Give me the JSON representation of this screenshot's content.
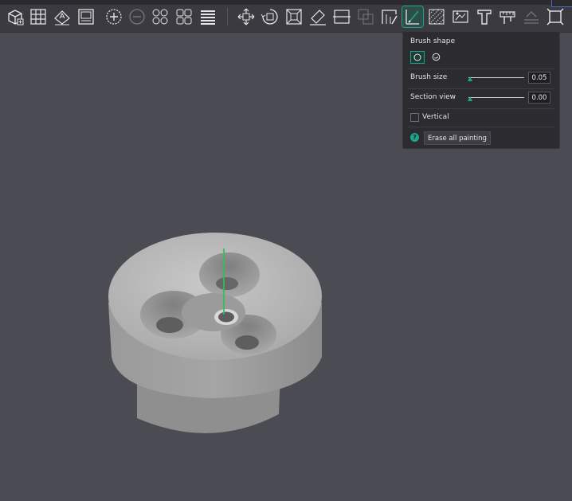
{
  "toolbar": {
    "items": [
      {
        "icon": "add-cube-icon"
      },
      {
        "icon": "grid-arrange-icon"
      },
      {
        "icon": "orient-icon"
      },
      {
        "icon": "plate-icon"
      },
      {
        "icon": "add-instance-icon"
      },
      {
        "icon": "remove-instance-icon"
      },
      {
        "icon": "split-objects-icon"
      },
      {
        "icon": "split-parts-icon"
      },
      {
        "icon": "layers-icon"
      },
      {
        "icon": "move-icon"
      },
      {
        "icon": "rotate-icon"
      },
      {
        "icon": "scale-icon"
      },
      {
        "icon": "lay-on-face-icon"
      },
      {
        "icon": "cut-icon"
      },
      {
        "icon": "mesh-boolean-icon"
      },
      {
        "icon": "support-paint-icon"
      },
      {
        "icon": "seam-paint-icon"
      },
      {
        "icon": "fuzzy-skin-paint-icon"
      },
      {
        "icon": "color-paint-icon"
      },
      {
        "icon": "text-icon"
      },
      {
        "icon": "measure-icon"
      },
      {
        "icon": "assembly-icon"
      },
      {
        "icon": "fit-view-icon"
      }
    ]
  },
  "panel": {
    "brush_shape_label": "Brush shape",
    "brush_size_label": "Brush size",
    "brush_size_value": "0.05",
    "section_view_label": "Section view",
    "section_view_value": "0.00",
    "vertical_label": "Vertical",
    "vertical_checked": false,
    "help_glyph": "?",
    "erase_label": "Erase all painting"
  },
  "colors": {
    "accent": "#1fa38a",
    "viewport_bg": "#4b4b53",
    "panel_bg": "#2b2b30",
    "model": "#b8b8b8",
    "axis": "#2fbf5a"
  }
}
